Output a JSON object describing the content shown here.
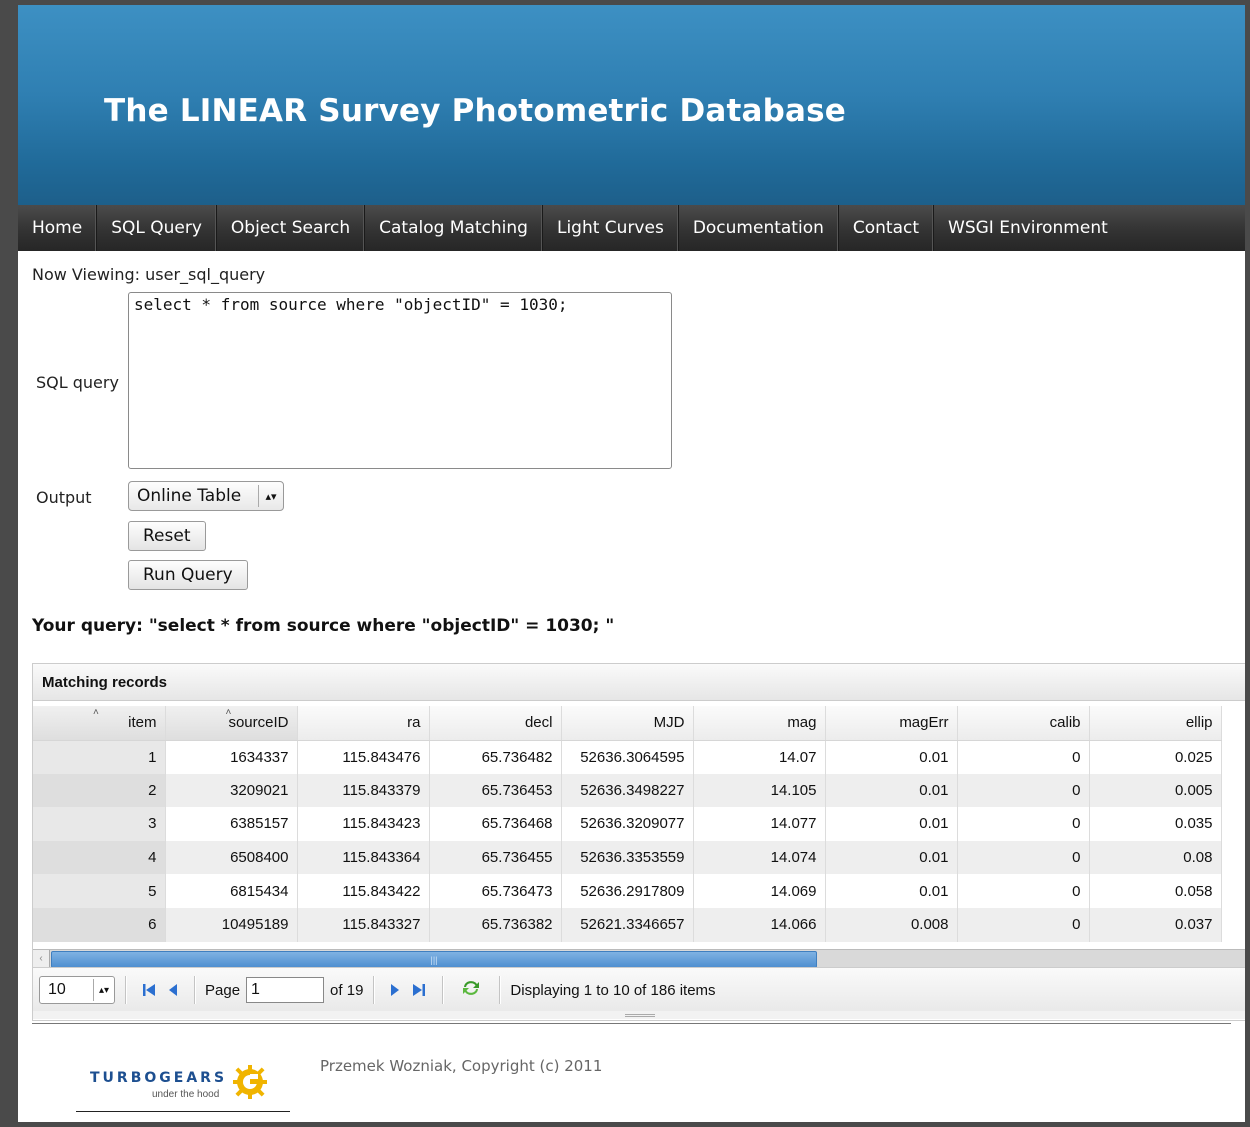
{
  "header": {
    "title": "The LINEAR Survey Photometric Database"
  },
  "nav": {
    "items": [
      "Home",
      "SQL Query",
      "Object Search",
      "Catalog Matching",
      "Light Curves",
      "Documentation",
      "Contact",
      "WSGI Environment"
    ]
  },
  "form": {
    "now_viewing": "Now Viewing: user_sql_query",
    "sql_label": "SQL query",
    "sql_value": "select * from source where \"objectID\" = 1030;",
    "output_label": "Output",
    "output_selected": "Online Table",
    "reset_label": "Reset",
    "run_label": "Run Query"
  },
  "query_echo": "Your query: \"select * from source where \"objectID\" = 1030; \"",
  "grid": {
    "title": "Matching records",
    "columns": [
      "item",
      "sourceID",
      "ra",
      "decl",
      "MJD",
      "mag",
      "magErr",
      "calib",
      "ellip"
    ],
    "rows": [
      [
        "1",
        "1634337",
        "115.843476",
        "65.736482",
        "52636.3064595",
        "14.07",
        "0.01",
        "0",
        "0.025"
      ],
      [
        "2",
        "3209021",
        "115.843379",
        "65.736453",
        "52636.3498227",
        "14.105",
        "0.01",
        "0",
        "0.005"
      ],
      [
        "3",
        "6385157",
        "115.843423",
        "65.736468",
        "52636.3209077",
        "14.077",
        "0.01",
        "0",
        "0.035"
      ],
      [
        "4",
        "6508400",
        "115.843364",
        "65.736455",
        "52636.3353559",
        "14.074",
        "0.01",
        "0",
        "0.08"
      ],
      [
        "5",
        "6815434",
        "115.843422",
        "65.736473",
        "52636.2917809",
        "14.069",
        "0.01",
        "0",
        "0.058"
      ],
      [
        "6",
        "10495189",
        "115.843327",
        "65.736382",
        "52621.3346657",
        "14.066",
        "0.008",
        "0",
        "0.037"
      ]
    ]
  },
  "pager": {
    "page_size": "10",
    "page_label": "Page",
    "page_value": "1",
    "of_label": "of 19",
    "display_text": "Displaying 1 to 10 of 186 items"
  },
  "footer": {
    "logo_word": "TURBOGEARS",
    "logo_sub": "under the hood",
    "copyright": "Przemek Wozniak, Copyright (c) 2011"
  }
}
